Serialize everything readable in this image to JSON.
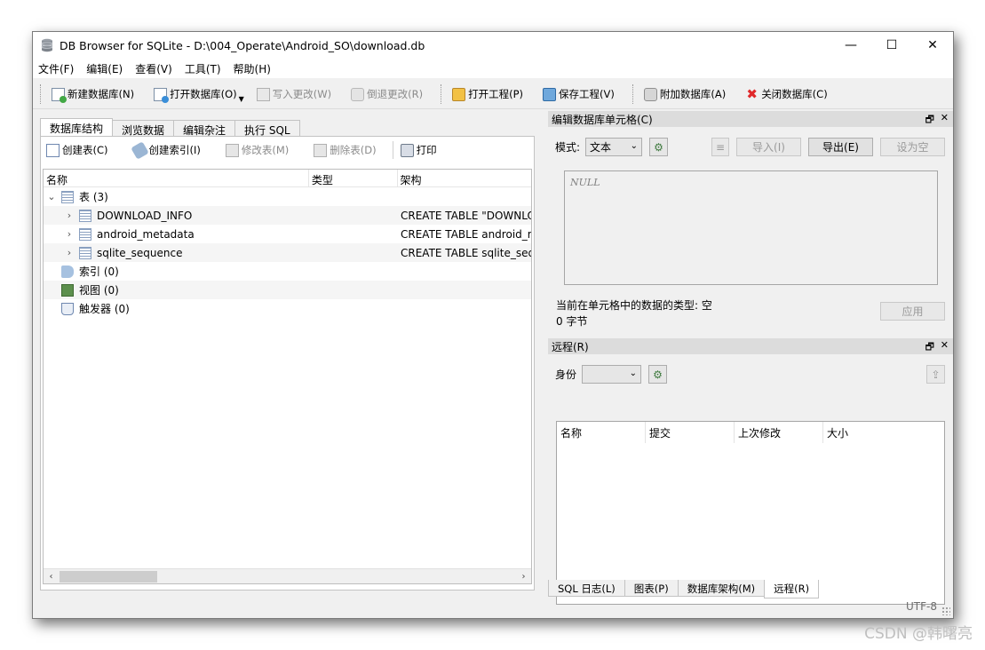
{
  "window": {
    "title": "DB Browser for SQLite - D:\\004_Operate\\Android_SO\\download.db",
    "minimize": "—",
    "maximize": "☐",
    "close": "✕"
  },
  "menu": [
    "文件(F)",
    "编辑(E)",
    "查看(V)",
    "工具(T)",
    "帮助(H)"
  ],
  "toolbar": {
    "new_db": "新建数据库(N)",
    "open_db": "打开数据库(O)",
    "write_changes": "写入更改(W)",
    "revert_changes": "倒退更改(R)",
    "open_project": "打开工程(P)",
    "save_project": "保存工程(V)",
    "attach_db": "附加数据库(A)",
    "close_db": "关闭数据库(C)"
  },
  "left_tabs": [
    "数据库结构",
    "浏览数据",
    "编辑杂注",
    "执行 SQL"
  ],
  "structure_toolbar": {
    "create_table": "创建表(C)",
    "create_index": "创建索引(I)",
    "modify_table": "修改表(M)",
    "delete_table": "删除表(D)",
    "print": "打印"
  },
  "tree": {
    "columns": [
      "名称",
      "类型",
      "架构"
    ],
    "tables_node": "表 (3)",
    "tables": [
      {
        "name": "DOWNLOAD_INFO",
        "schema": "CREATE TABLE \"DOWNLO"
      },
      {
        "name": "android_metadata",
        "schema": "CREATE TABLE android_m"
      },
      {
        "name": "sqlite_sequence",
        "schema": "CREATE TABLE sqlite_seq"
      }
    ],
    "indexes_node": "索引 (0)",
    "views_node": "视图 (0)",
    "triggers_node": "触发器 (0)"
  },
  "edit_cell": {
    "title": "编辑数据库单元格(C)",
    "mode_label": "模式:",
    "mode_value": "文本",
    "import": "导入(I)",
    "export": "导出(E)",
    "set_null": "设为空",
    "content": "NULL",
    "type_info": "当前在单元格中的数据的类型: 空",
    "size_info": "0 字节",
    "apply": "应用"
  },
  "remote": {
    "title": "远程(R)",
    "identity_label": "身份",
    "columns": [
      "名称",
      "提交",
      "上次修改",
      "大小"
    ]
  },
  "bottom_tabs": [
    "SQL 日志(L)",
    "图表(P)",
    "数据库架构(M)",
    "远程(R)"
  ],
  "status": {
    "encoding": "UTF-8"
  },
  "watermark": "CSDN @韩曙亮"
}
